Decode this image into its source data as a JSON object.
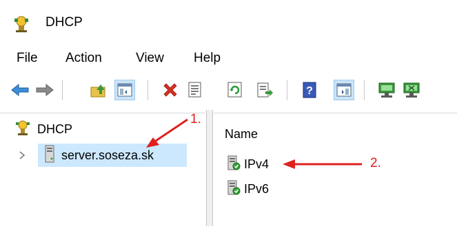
{
  "window": {
    "title": "DHCP",
    "icon": "dhcp-server-icon"
  },
  "menu": [
    {
      "label": "File"
    },
    {
      "label": "Action"
    },
    {
      "label": "View"
    },
    {
      "label": "Help"
    }
  ],
  "toolbar": {
    "buttons": [
      {
        "icon": "back-arrow-icon"
      },
      {
        "icon": "forward-arrow-icon"
      },
      {
        "icon": "up-folder-icon"
      },
      {
        "icon": "show-hide-console-tree-icon",
        "pressed": true
      },
      {
        "icon": "delete-icon"
      },
      {
        "icon": "properties-icon"
      },
      {
        "icon": "refresh-icon"
      },
      {
        "icon": "export-list-icon"
      },
      {
        "icon": "help-icon"
      },
      {
        "icon": "show-hide-action-pane-icon",
        "pressed": true
      },
      {
        "icon": "authorize-server-icon"
      },
      {
        "icon": "unauthorize-server-icon"
      }
    ]
  },
  "tree": {
    "root": {
      "label": "DHCP",
      "icon": "dhcp-icon"
    },
    "server": {
      "label": "server.soseza.sk",
      "icon": "server-icon",
      "selected": true,
      "expander": "chevron-right-icon"
    }
  },
  "details": {
    "column_header": "Name",
    "items": [
      {
        "label": "IPv4",
        "icon": "ipv4-scope-icon"
      },
      {
        "label": "IPv6",
        "icon": "ipv6-scope-icon"
      }
    ]
  },
  "annotations": {
    "step1": "1.",
    "step2": "2.",
    "color": "#e02020"
  }
}
